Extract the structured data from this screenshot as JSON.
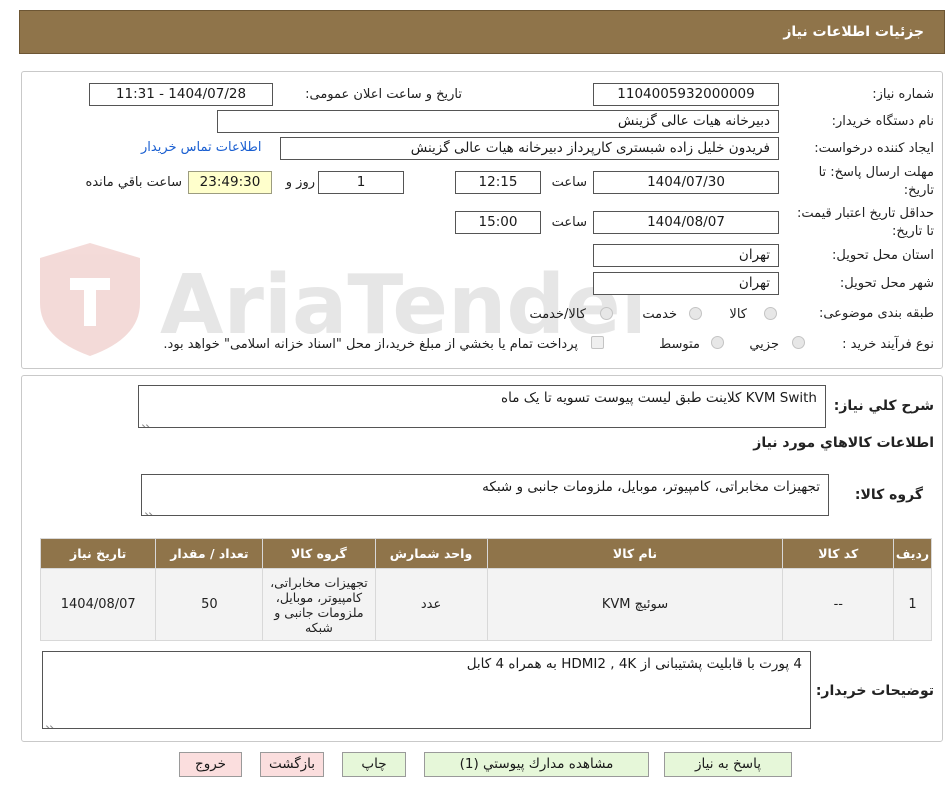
{
  "header": {
    "title": "جزئیات اطلاعات نیاز"
  },
  "labels": {
    "need_number": "شماره نیاز:",
    "announce_datetime": "تاریخ و ساعت اعلان عمومی:",
    "buyer_org": "نام دستگاه خریدار:",
    "requester": "ایجاد کننده درخواست:",
    "deadline_send": "مهلت ارسال پاسخ: تا تاریخ:",
    "deadline_price": "حداقل تاریخ اعتبار قیمت: تا تاریخ:",
    "province": "استان محل تحویل:",
    "city": "شهر محل تحویل:",
    "category": "طبقه بندی موضوعی:",
    "purchase_type": "نوع فرآیند خرید :",
    "time_word": "ساعت",
    "day_word": "روز و",
    "remaining": "ساعت باقي مانده",
    "need_desc": "شرح كلي نياز:",
    "goods_info": "اطلاعات كالاهاي مورد نياز",
    "goods_group": "گروه کالا:",
    "buyer_notes": "توضیحات خریدار:"
  },
  "fields": {
    "need_number": "1104005932000009",
    "announce_datetime": "1404/07/28 - 11:31",
    "buyer_org": "دبیرخانه هیات عالی گزینش",
    "requester": "فریدون  خلیل زاده شبستری  کارپرداز دبیرخانه هیات عالی گزینش",
    "contact_link": "اطلاعات تماس خریدار",
    "send_date": "1404/07/30",
    "send_time": "12:15",
    "days": "1",
    "remaining_time": "23:49:30",
    "price_date": "1404/08/07",
    "price_time": "15:00",
    "province": "تهران",
    "city": "تهران"
  },
  "category_options": {
    "kala": "كالا",
    "khedmat": "خدمت",
    "kala_khedmat": "كالا/خدمت"
  },
  "purchase_options": {
    "jozei": "جزيي",
    "motevaset": "متوسط",
    "payment_note": "پرداخت تمام يا بخشي از مبلغ خريد،از محل \"اسناد خزانه اسلامی\" خواهد بود."
  },
  "need_description": "KVM Swith کلاینت طبق لیست پیوست تسویه تا یک ماه",
  "goods_group_value": "تجهیزات مخابراتی، کامپیوتر، موبایل، ملزومات جانبی و شبکه",
  "table": {
    "headers": [
      "رديف",
      "كد كالا",
      "نام كالا",
      "واحد شمارش",
      "گروه كالا",
      "تعداد / مقدار",
      "تاريخ نياز"
    ],
    "rows": [
      [
        "1",
        "--",
        "سوئیچ KVM",
        "عدد",
        "تجهیزات مخابراتی، کامپیوتر، موبایل، ملزومات جانبی و شبکه",
        "50",
        "1404/08/07"
      ]
    ]
  },
  "buyer_notes_value": "4 پورت با قابلیت پشتیبانی از HDMI2 , 4K به همراه 4 کابل",
  "buttons": {
    "reply": "پاسخ به نياز",
    "attachments": "مشاهده مدارك پيوستي (1)",
    "print": "چاپ",
    "back": "بازگشت",
    "exit": "خروج"
  },
  "watermark": {
    "text": "AriaTender.neT"
  },
  "colors": {
    "header_bg": "#8f744a",
    "button_green": "#e6f7d9",
    "button_red": "#fbdede",
    "timer_bg": "#ffffcc",
    "link": "#1a5fd1"
  }
}
